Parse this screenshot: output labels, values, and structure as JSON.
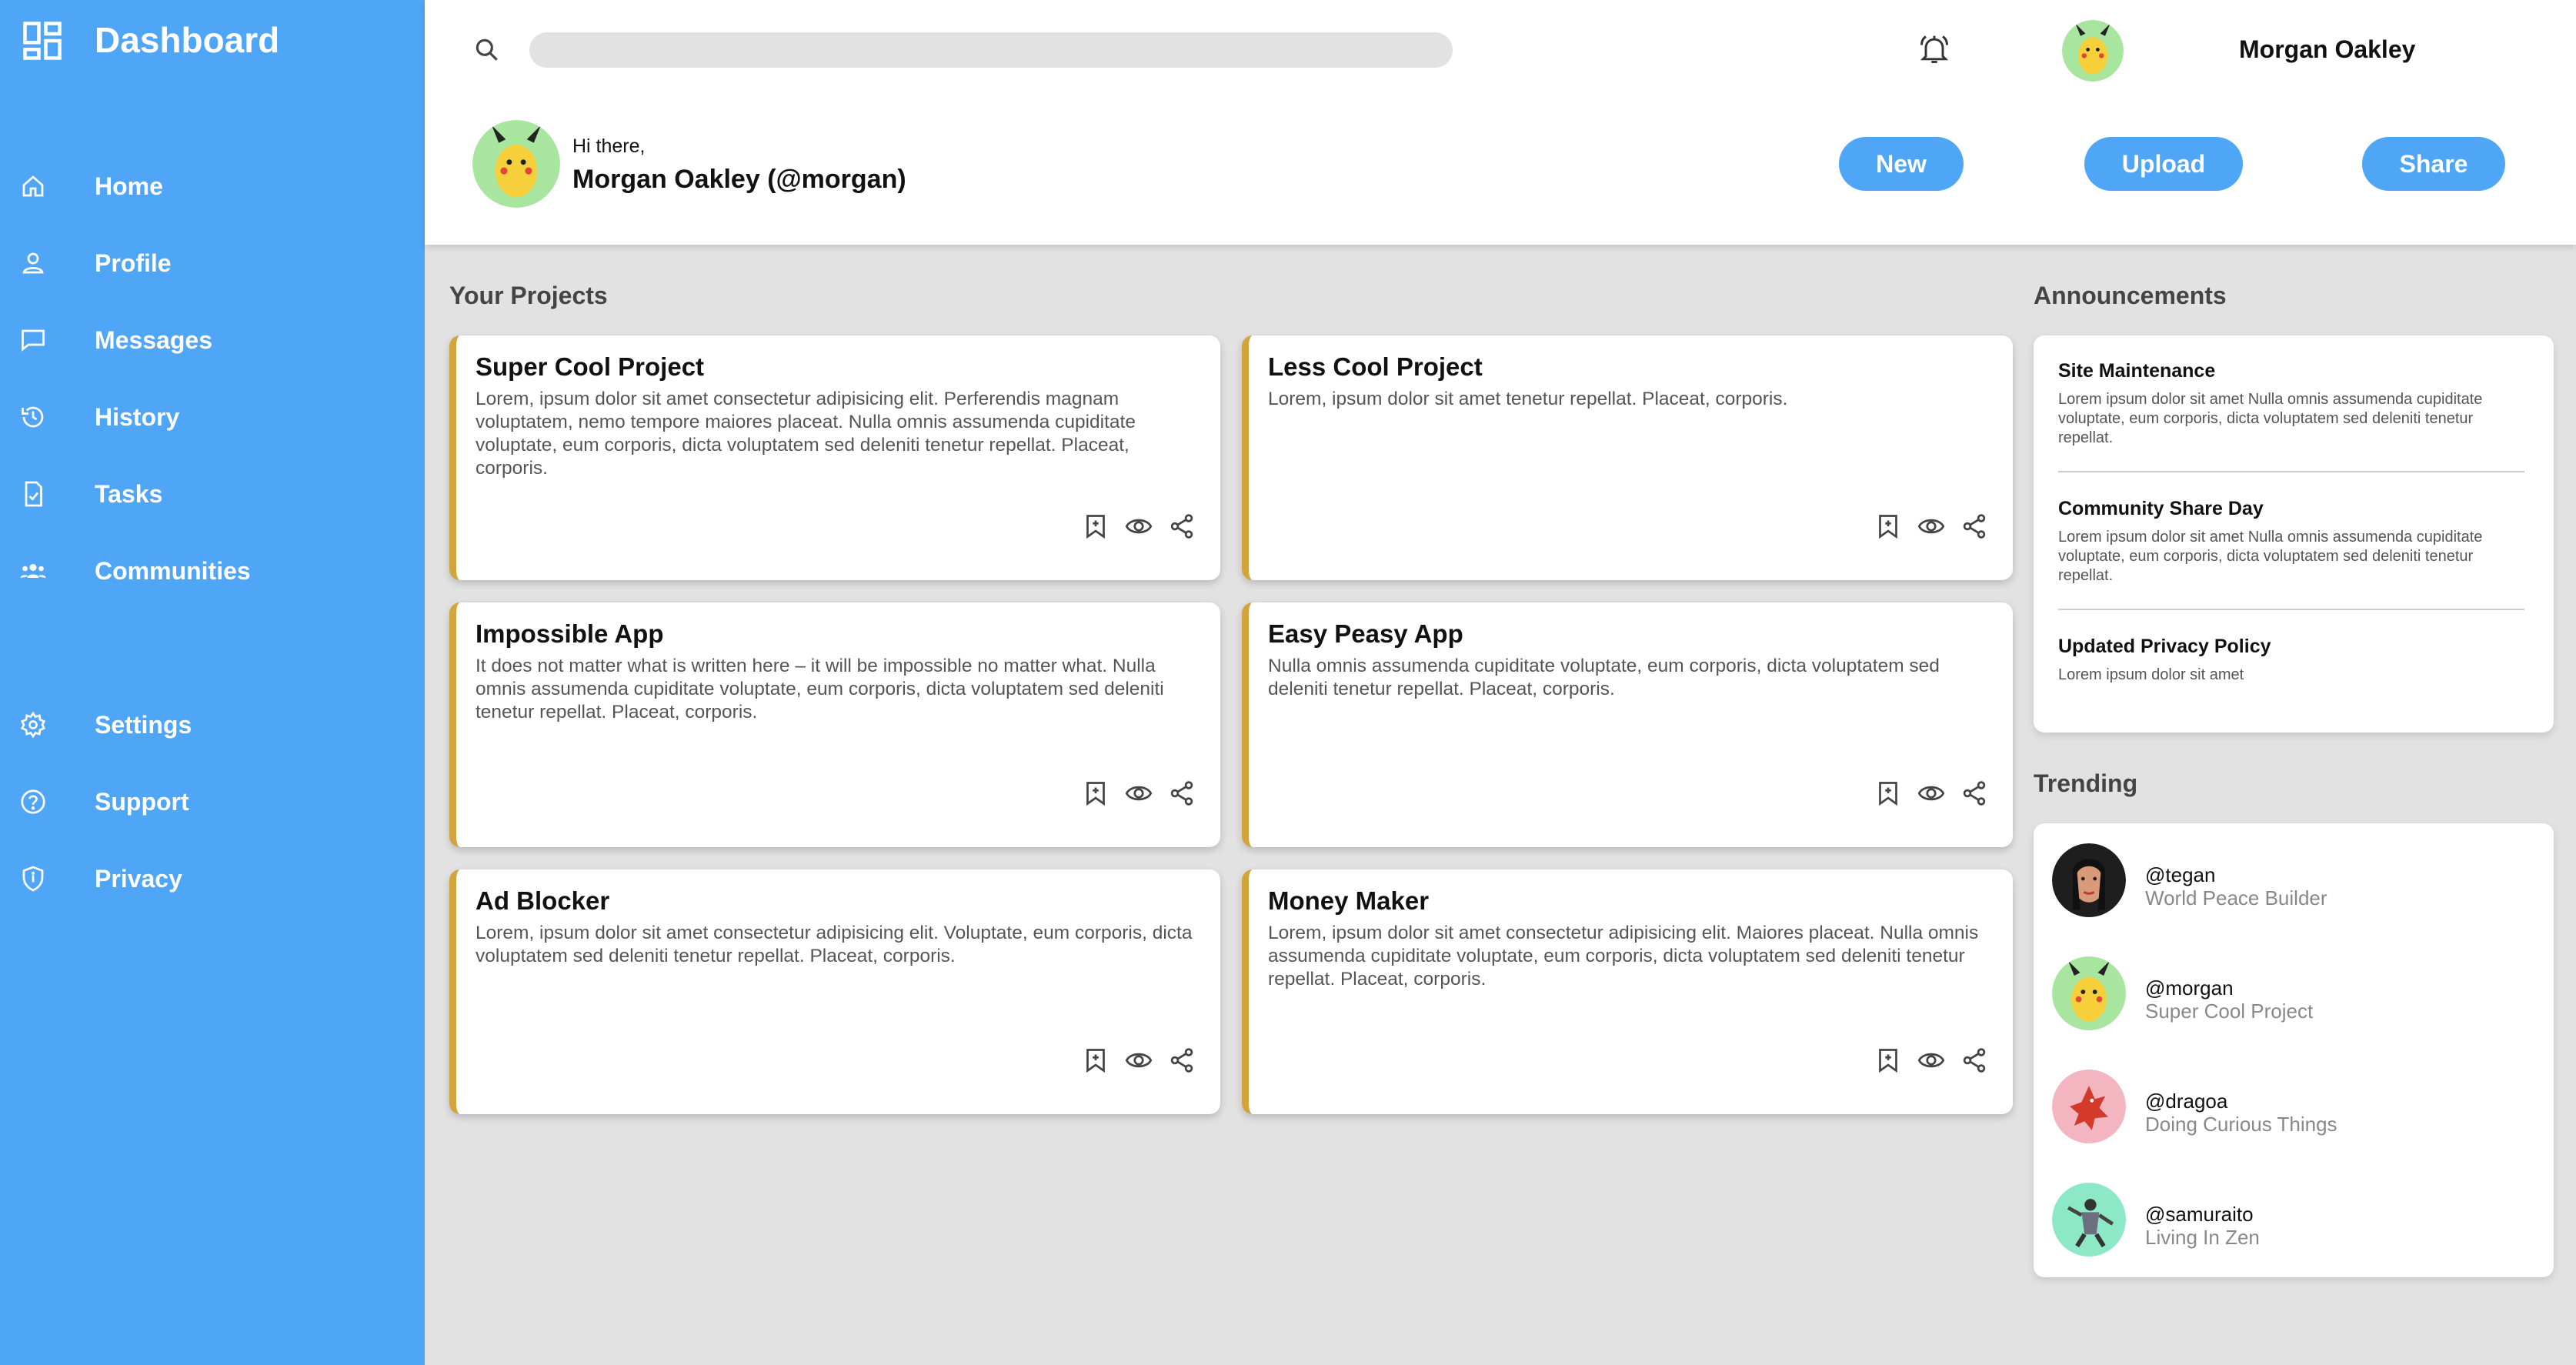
{
  "sidebar": {
    "title": "Dashboard",
    "items": [
      {
        "label": "Home",
        "icon": "home-icon"
      },
      {
        "label": "Profile",
        "icon": "profile-icon"
      },
      {
        "label": "Messages",
        "icon": "messages-icon"
      },
      {
        "label": "History",
        "icon": "history-icon"
      },
      {
        "label": "Tasks",
        "icon": "tasks-icon"
      },
      {
        "label": "Communities",
        "icon": "communities-icon"
      },
      {
        "label": "Settings",
        "icon": "gear-icon"
      },
      {
        "label": "Support",
        "icon": "help-icon"
      },
      {
        "label": "Privacy",
        "icon": "shield-icon"
      }
    ]
  },
  "header": {
    "search": {
      "value": "",
      "placeholder": ""
    },
    "user_name": "Morgan Oakley",
    "greeting_small": "Hi there,",
    "greeting_name": "Morgan Oakley (@morgan)",
    "buttons": {
      "new": "New",
      "upload": "Upload",
      "share": "Share"
    }
  },
  "projects": {
    "title": "Your Projects",
    "cards": [
      {
        "title": "Super Cool Project",
        "body": "Lorem, ipsum dolor sit amet consectetur adipisicing elit. Perferendis magnam voluptatem, nemo tempore maiores placeat. Nulla omnis assumenda cupiditate voluptate, eum corporis, dicta voluptatem sed deleniti tenetur repellat. Placeat, corporis."
      },
      {
        "title": "Less Cool Project",
        "body": "Lorem, ipsum dolor sit amet tenetur repellat. Placeat, corporis."
      },
      {
        "title": "Impossible App",
        "body": "It does not matter what is written here – it will be impossible no matter what. Nulla omnis assumenda cupiditate voluptate, eum corporis, dicta voluptatem sed deleniti tenetur repellat. Placeat, corporis."
      },
      {
        "title": "Easy Peasy App",
        "body": "Nulla omnis assumenda cupiditate voluptate, eum corporis, dicta voluptatem sed deleniti tenetur repellat. Placeat, corporis."
      },
      {
        "title": "Ad Blocker",
        "body": "Lorem, ipsum dolor sit amet consectetur adipisicing elit. Voluptate, eum corporis, dicta voluptatem sed deleniti tenetur repellat. Placeat, corporis."
      },
      {
        "title": "Money Maker",
        "body": "Lorem, ipsum dolor sit amet consectetur adipisicing elit. Maiores placeat. Nulla omnis assumenda cupiditate voluptate, eum corporis, dicta voluptatem sed deleniti tenetur repellat. Placeat, corporis."
      }
    ]
  },
  "announcements": {
    "title": "Announcements",
    "items": [
      {
        "title": "Site Maintenance",
        "text": "Lorem ipsum dolor sit amet Nulla omnis assumenda cupiditate voluptate, eum corporis, dicta voluptatem sed deleniti tenetur repellat."
      },
      {
        "title": "Community Share Day",
        "text": "Lorem ipsum dolor sit amet Nulla omnis assumenda cupiditate voluptate, eum corporis, dicta voluptatem sed deleniti tenetur repellat."
      },
      {
        "title": "Updated Privacy Policy",
        "text": "Lorem ipsum dolor sit amet"
      }
    ]
  },
  "trending": {
    "title": "Trending",
    "items": [
      {
        "handle": "@tegan",
        "subtitle": "World Peace Builder",
        "avatar_bg": "#1e1e1e"
      },
      {
        "handle": "@morgan",
        "subtitle": "Super Cool Project",
        "avatar_bg": "#a8e6a0"
      },
      {
        "handle": "@dragoa",
        "subtitle": "Doing Curious Things",
        "avatar_bg": "#f3b6c0"
      },
      {
        "handle": "@samuraito",
        "subtitle": "Living In Zen",
        "avatar_bg": "#8de8c8"
      }
    ]
  },
  "colors": {
    "accent": "#4fa6f6",
    "card_border": "#d4a43c",
    "background": "#e2e2e2"
  }
}
